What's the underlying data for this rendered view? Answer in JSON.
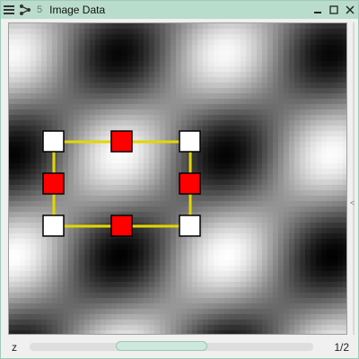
{
  "window": {
    "title": "Image Data",
    "number": "5",
    "icons": [
      "menu-icon",
      "share-icon",
      "minimize-icon",
      "maximize-icon",
      "close-icon"
    ]
  },
  "viewer": {
    "image": "grayscale-cosine-pattern",
    "shapes": [
      {
        "color": "#ffffff",
        "kind": "vertex"
      },
      {
        "color": "#ff0000",
        "kind": "midpoint"
      },
      {
        "color": "#ffd700",
        "kind": "edge"
      }
    ]
  },
  "footer": {
    "axis_label": "z",
    "page_indicator": "1/2",
    "slider_position": 0.45
  },
  "colors": {
    "titlebar": "#b9dccd",
    "accent": "#9cc7b6",
    "handle_red": "#ff0000",
    "edge_yellow": "#e3d600"
  }
}
